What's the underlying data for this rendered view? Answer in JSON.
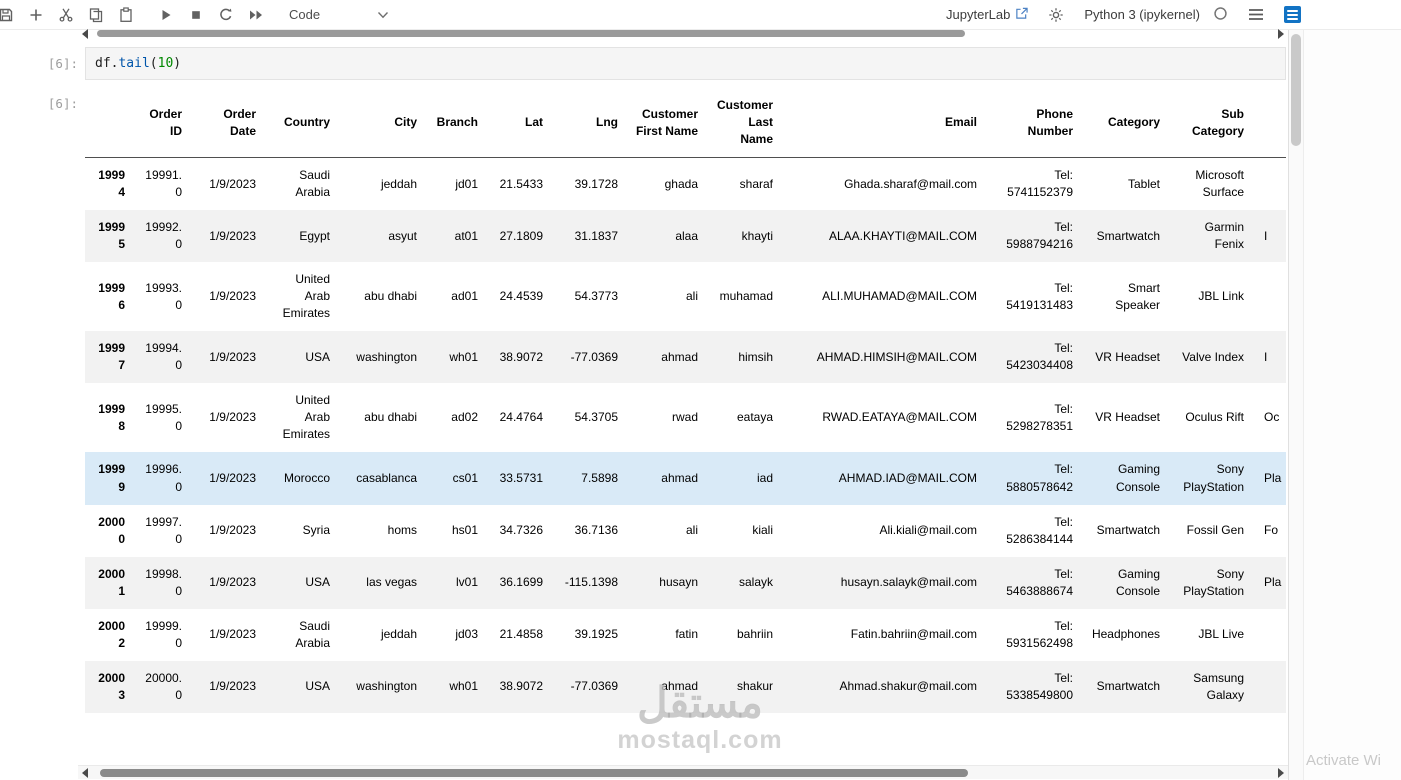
{
  "toolbar": {
    "cell_type_label": "Code",
    "jupyterlab_label": "JupyterLab",
    "kernel_name": "Python 3 (ipykernel)"
  },
  "cell": {
    "input_prompt": "[6]:",
    "output_prompt": "[6]:",
    "code_tokens": {
      "obj": "df",
      "dot": ".",
      "method": "tail",
      "paren_open": "(",
      "number": "10",
      "paren_close": ")"
    }
  },
  "table": {
    "columns": [
      "",
      "Order ID",
      "Order Date",
      "Country",
      "City",
      "Branch",
      "Lat",
      "Lng",
      "Customer First Name",
      "Customer Last Name",
      "Email",
      "Phone Number",
      "Category",
      "Sub Category",
      ""
    ],
    "highlight_row": 5,
    "rows": [
      {
        "cells": [
          "19994",
          "19991.0",
          "1/9/2023",
          "Saudi Arabia",
          "jeddah",
          "jd01",
          "21.5433",
          "39.1728",
          "ghada",
          "sharaf",
          "Ghada.sharaf@mail.com",
          "Tel: 5741152379",
          "Tablet",
          "Microsoft Surface",
          ""
        ]
      },
      {
        "cells": [
          "19995",
          "19992.0",
          "1/9/2023",
          "Egypt",
          "asyut",
          "at01",
          "27.1809",
          "31.1837",
          "alaa",
          "khayti",
          "ALAA.KHAYTI@MAIL.COM",
          "Tel: 5988794216",
          "Smartwatch",
          "Garmin Fenix",
          "I"
        ]
      },
      {
        "cells": [
          "19996",
          "19993.0",
          "1/9/2023",
          "United Arab Emirates",
          "abu dhabi",
          "ad01",
          "24.4539",
          "54.3773",
          "ali",
          "muhamad",
          "ALI.MUHAMAD@MAIL.COM",
          "Tel: 5419131483",
          "Smart Speaker",
          "JBL Link",
          ""
        ]
      },
      {
        "cells": [
          "19997",
          "19994.0",
          "1/9/2023",
          "USA",
          "washington",
          "wh01",
          "38.9072",
          "-77.0369",
          "ahmad",
          "himsih",
          "AHMAD.HIMSIH@MAIL.COM",
          "Tel: 5423034408",
          "VR Headset",
          "Valve Index",
          "I"
        ]
      },
      {
        "cells": [
          "19998",
          "19995.0",
          "1/9/2023",
          "United Arab Emirates",
          "abu dhabi",
          "ad02",
          "24.4764",
          "54.3705",
          "rwad",
          "eataya",
          "RWAD.EATAYA@MAIL.COM",
          "Tel: 5298278351",
          "VR Headset",
          "Oculus Rift",
          "Oc"
        ]
      },
      {
        "cells": [
          "19999",
          "19996.0",
          "1/9/2023",
          "Morocco",
          "casablanca",
          "cs01",
          "33.5731",
          "7.5898",
          "ahmad",
          "iad",
          "AHMAD.IAD@MAIL.COM",
          "Tel: 5880578642",
          "Gaming Console",
          "Sony PlayStation",
          "Pla"
        ]
      },
      {
        "cells": [
          "20000",
          "19997.0",
          "1/9/2023",
          "Syria",
          "homs",
          "hs01",
          "34.7326",
          "36.7136",
          "ali",
          "kiali",
          "Ali.kiali@mail.com",
          "Tel: 5286384144",
          "Smartwatch",
          "Fossil Gen",
          "Fo"
        ]
      },
      {
        "cells": [
          "20001",
          "19998.0",
          "1/9/2023",
          "USA",
          "las vegas",
          "lv01",
          "36.1699",
          "-115.1398",
          "husayn",
          "salayk",
          "husayn.salayk@mail.com",
          "Tel: 5463888674",
          "Gaming Console",
          "Sony PlayStation",
          "Pla"
        ]
      },
      {
        "cells": [
          "20002",
          "19999.0",
          "1/9/2023",
          "Saudi Arabia",
          "jeddah",
          "jd03",
          "21.4858",
          "39.1925",
          "fatin",
          "bahriin",
          "Fatin.bahriin@mail.com",
          "Tel: 5931562498",
          "Headphones",
          "JBL Live",
          ""
        ]
      },
      {
        "cells": [
          "20003",
          "20000.0",
          "1/9/2023",
          "USA",
          "washington",
          "wh01",
          "38.9072",
          "-77.0369",
          "ahmad",
          "shakur",
          "Ahmad.shakur@mail.com",
          "Tel: 5338549800",
          "Smartwatch",
          "Samsung Galaxy",
          ""
        ]
      }
    ]
  },
  "watermark": {
    "arabic": "مستقل",
    "latin": "mostaql.com"
  },
  "background_text": "Activate Wi"
}
